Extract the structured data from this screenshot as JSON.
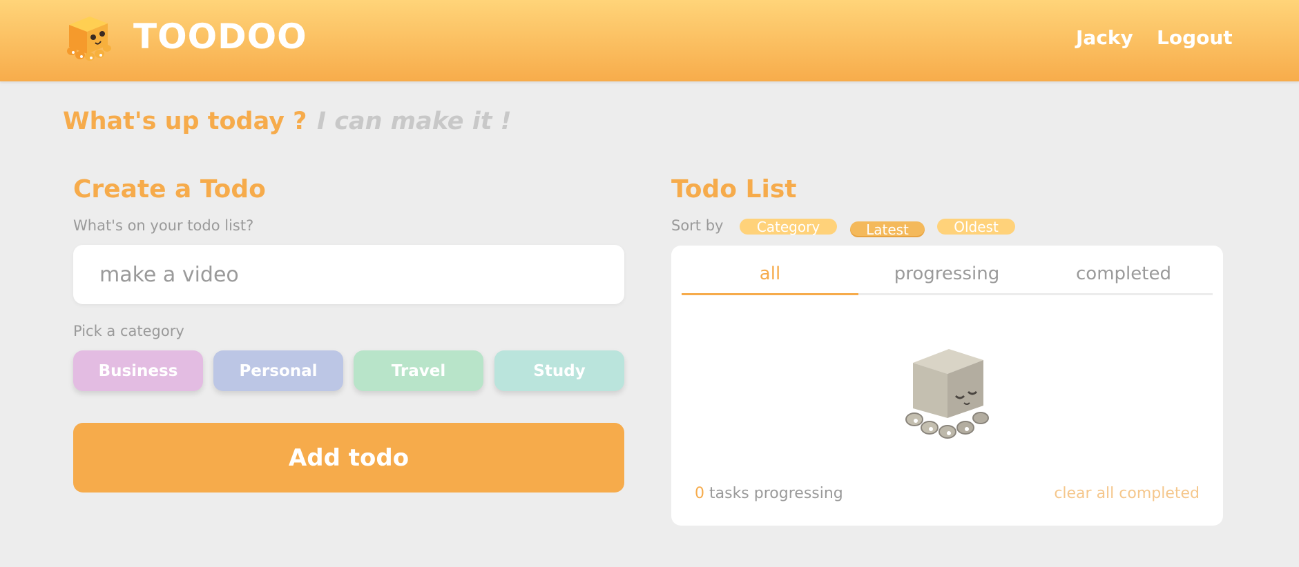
{
  "header": {
    "brand": "TOODOO",
    "user": "Jacky",
    "logout": "Logout",
    "logo_icon": "octopus-cube-icon"
  },
  "greeting": {
    "title": "What's up today ?",
    "subtitle": "I can make it !"
  },
  "create": {
    "title": "Create a Todo",
    "input_label": "What's on your todo list?",
    "input_placeholder": "make a video",
    "category_label": "Pick a category",
    "categories": [
      "Business",
      "Personal",
      "Travel",
      "Study"
    ],
    "add_button": "Add todo"
  },
  "list": {
    "title": "Todo List",
    "sort_label": "Sort by",
    "sort_options": [
      "Category",
      "Latest",
      "Oldest"
    ],
    "tabs": [
      "all",
      "progressing",
      "completed"
    ],
    "active_tab": "all",
    "empty_icon": "sleeping-octopus-icon",
    "progress_count": "0",
    "progress_text": "tasks progressing",
    "clear_completed": "clear all completed"
  },
  "colors": {
    "accent": "#f6ab4b",
    "header_top": "#ffd479",
    "header_bottom": "#f7ac4b",
    "business": "#e3bce2",
    "personal": "#bcc6e5",
    "travel": "#b8e4c9",
    "study": "#bae4dc"
  }
}
